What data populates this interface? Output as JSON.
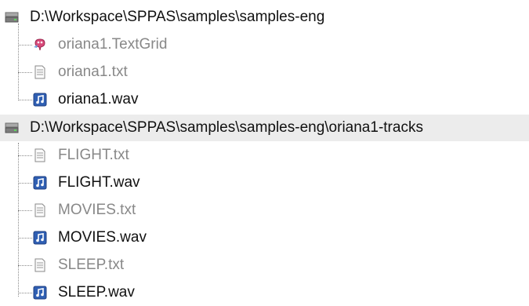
{
  "tree": {
    "folders": [
      {
        "path": "D:\\Workspace\\SPPAS\\samples\\samples-eng",
        "icon": "drive-icon",
        "files": [
          {
            "name": "oriana1.TextGrid",
            "icon": "textgrid-icon",
            "enabled": false
          },
          {
            "name": "oriana1.txt",
            "icon": "text-file-icon",
            "enabled": false
          },
          {
            "name": "oriana1.wav",
            "icon": "audio-file-icon",
            "enabled": true
          }
        ]
      },
      {
        "path": "D:\\Workspace\\SPPAS\\samples\\samples-eng\\oriana1-tracks",
        "icon": "drive-icon",
        "files": [
          {
            "name": "FLIGHT.txt",
            "icon": "text-file-icon",
            "enabled": false
          },
          {
            "name": "FLIGHT.wav",
            "icon": "audio-file-icon",
            "enabled": true
          },
          {
            "name": "MOVIES.txt",
            "icon": "text-file-icon",
            "enabled": false
          },
          {
            "name": "MOVIES.wav",
            "icon": "audio-file-icon",
            "enabled": true
          },
          {
            "name": "SLEEP.txt",
            "icon": "text-file-icon",
            "enabled": false
          },
          {
            "name": "SLEEP.wav",
            "icon": "audio-file-icon",
            "enabled": true
          }
        ]
      }
    ]
  },
  "colors": {
    "enabled_text": "#111111",
    "disabled_text": "#888888",
    "audio_icon": "#2f5fb3",
    "folder_highlight": "#ececec"
  }
}
